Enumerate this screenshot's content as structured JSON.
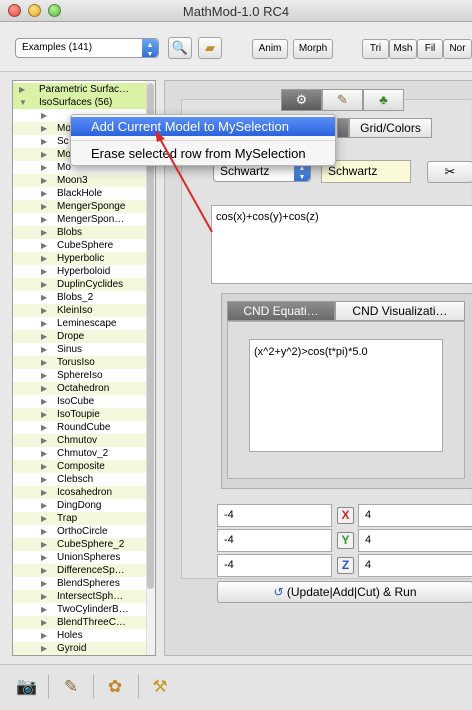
{
  "window": {
    "title": "MathMod-1.0 RC4"
  },
  "toolbar": {
    "examples_select": "Examples (141)",
    "anim": "Anim",
    "morph": "Morph",
    "tri": "Tri",
    "msh": "Msh",
    "fil": "Fil",
    "nor": "Nor",
    "zoom_icon": "magnifier-icon",
    "note_icon": "notepad-icon"
  },
  "tree": {
    "groups": [
      {
        "label": "Parametric Surfac…",
        "expanded": false
      },
      {
        "label": "IsoSurfaces (56)",
        "expanded": true
      }
    ],
    "items": [
      "",
      "Mo",
      "Sc",
      "Mo",
      "Mo",
      "Moon3",
      "BlackHole",
      "MengerSponge",
      "MengerSpon…",
      "Blobs",
      "CubeSphere",
      "Hyperbolic",
      "Hyperboloid",
      "DuplinCyclides",
      "Blobs_2",
      "KleinIso",
      "Leminescape",
      "Drope",
      "Sinus",
      "TorusIso",
      "SphereIso",
      "Octahedron",
      "IsoCube",
      "IsoToupie",
      "RoundCube",
      "Chmutov",
      "Chmutov_2",
      "Composite",
      "Clebsch",
      "Icosahedron",
      "DingDong",
      "Trap",
      "OrthoCircle",
      "CubeSphere_2",
      "UnionSpheres",
      "DifferenceSp…",
      "BlendSpheres",
      "IntersectSph…",
      "TwoCylinderB…",
      "BlendThreeC…",
      "Holes",
      "Gyroid"
    ]
  },
  "context_menu": {
    "items": [
      "Add Current Model to MySelection",
      "Erase selected row from MySelection"
    ]
  },
  "panel": {
    "top_tabs": [
      "gear-icon",
      "brush-icon",
      "tree-icon"
    ],
    "tab_gridcolors": "Grid/Colors",
    "model_select": "Schwartz",
    "model_name": "Schwartz",
    "equation": "cos(x)+cos(y)+cos(z)",
    "cnd_tabs": [
      "CND Equati…",
      "CND Visualizati…"
    ],
    "cnd_equation": "(x^2+y^2)>cos(t*pi)*5.0",
    "ranges": [
      {
        "axis": "X",
        "min": "-4",
        "max": "4",
        "color": "#d62a2a"
      },
      {
        "axis": "Y",
        "min": "-4",
        "max": "4",
        "color": "#2f9a2f"
      },
      {
        "axis": "Z",
        "min": "-4",
        "max": "4",
        "color": "#2a55c8"
      }
    ],
    "run_button": "(Update|Add|Cut) & Run"
  },
  "bottombar": {
    "icons": [
      "camera-icon",
      "script-icon",
      "palette-icon",
      "tools-icon"
    ]
  }
}
